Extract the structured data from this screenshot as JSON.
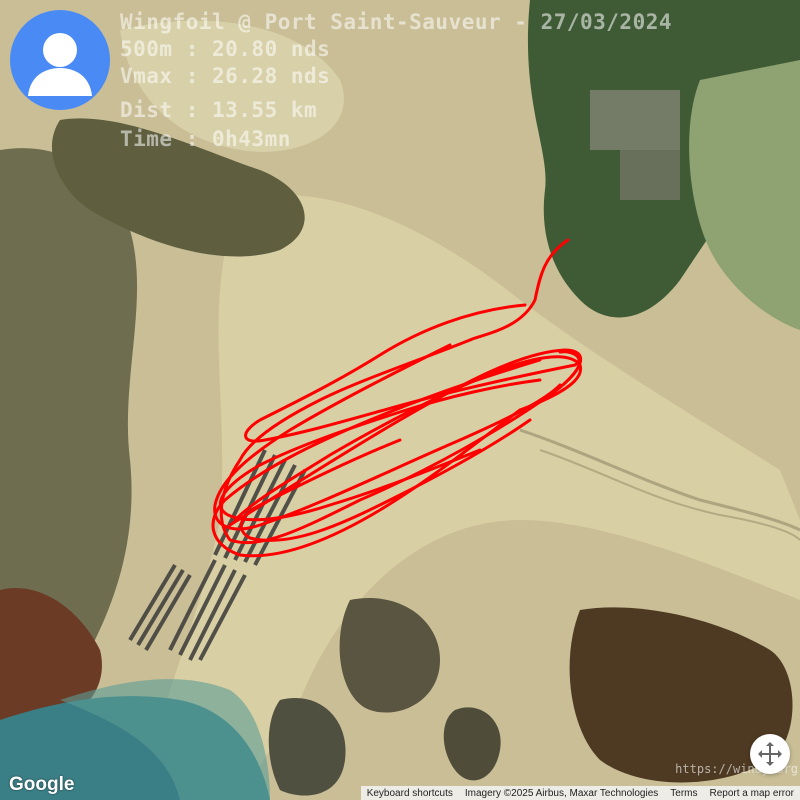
{
  "overlay": {
    "title": "Wingfoil @ Port Saint-Sauveur - 27/03/2024",
    "speed500": "500m : 20.80 nds",
    "vmax": "Vmax : 26.28 nds",
    "dist": "Dist : 13.55 km",
    "time": "Time : 0h43mn"
  },
  "watermark": "https://windy.org",
  "map": {
    "logo": "Google",
    "attribution": {
      "keyboard": "Keyboard shortcuts",
      "imagery": "Imagery ©2025 Airbus, Maxar Technologies",
      "terms": "Terms",
      "report": "Report a map error"
    }
  },
  "colors": {
    "track": "#ff0000",
    "avatar": "#4a8af4"
  },
  "icons": {
    "avatar": "person-icon",
    "fullscreen": "fullscreen-icon"
  }
}
